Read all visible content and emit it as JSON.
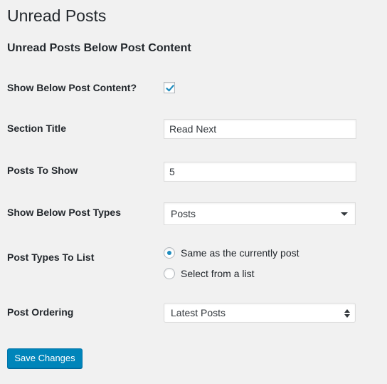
{
  "page": {
    "title": "Unread Posts",
    "section_title": "Unread Posts Below Post Content"
  },
  "fields": {
    "show_below": {
      "label": "Show Below Post Content?",
      "checked": true
    },
    "section_title": {
      "label": "Section Title",
      "value": "Read Next"
    },
    "posts_to_show": {
      "label": "Posts To Show",
      "value": "5"
    },
    "post_types": {
      "label": "Show Below Post Types",
      "selected": "Posts"
    },
    "post_types_list": {
      "label": "Post Types To List",
      "options": [
        {
          "label": "Same as the currently post",
          "selected": true
        },
        {
          "label": "Select from a list",
          "selected": false
        }
      ]
    },
    "ordering": {
      "label": "Post Ordering",
      "selected": "Latest Posts"
    }
  },
  "actions": {
    "save_label": "Save Changes"
  },
  "colors": {
    "background": "#f1f1f1",
    "accent": "#0085ba",
    "check": "#1e8cbe",
    "text": "#23282d"
  }
}
